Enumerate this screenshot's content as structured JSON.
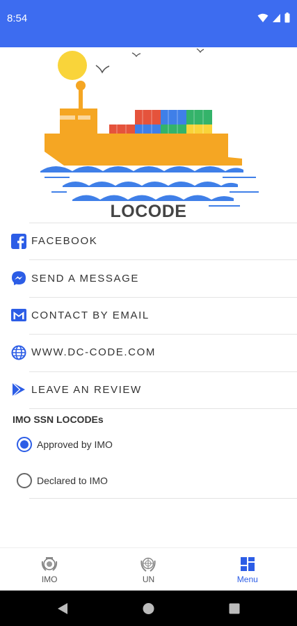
{
  "status_bar": {
    "time": "8:54"
  },
  "app": {
    "title": "LOCODE"
  },
  "menu": [
    {
      "label": "FACEBOOK",
      "icon": "facebook-icon"
    },
    {
      "label": "SEND A MESSAGE",
      "icon": "messenger-icon"
    },
    {
      "label": "CONTACT BY EMAIL",
      "icon": "email-icon"
    },
    {
      "label": "WWW.DC-CODE.COM",
      "icon": "globe-icon"
    },
    {
      "label": "LEAVE AN REVIEW",
      "icon": "play-store-icon"
    }
  ],
  "settings": {
    "section_title": "IMO SSN LOCODEs",
    "options": [
      {
        "label": "Approved by IMO",
        "selected": true
      },
      {
        "label": "Declared to IMO",
        "selected": false
      }
    ]
  },
  "bottom_nav": {
    "tabs": [
      {
        "label": "IMO",
        "icon": "imo-emblem-icon",
        "active": false
      },
      {
        "label": "UN",
        "icon": "un-emblem-icon",
        "active": false
      },
      {
        "label": "Menu",
        "icon": "dashboard-icon",
        "active": true
      }
    ]
  },
  "colors": {
    "accent": "#2c5de6",
    "status_bar": "#3d6cf0",
    "ship": "#f5a623",
    "sun": "#f9d43a",
    "waves": "#3f7fe8"
  }
}
